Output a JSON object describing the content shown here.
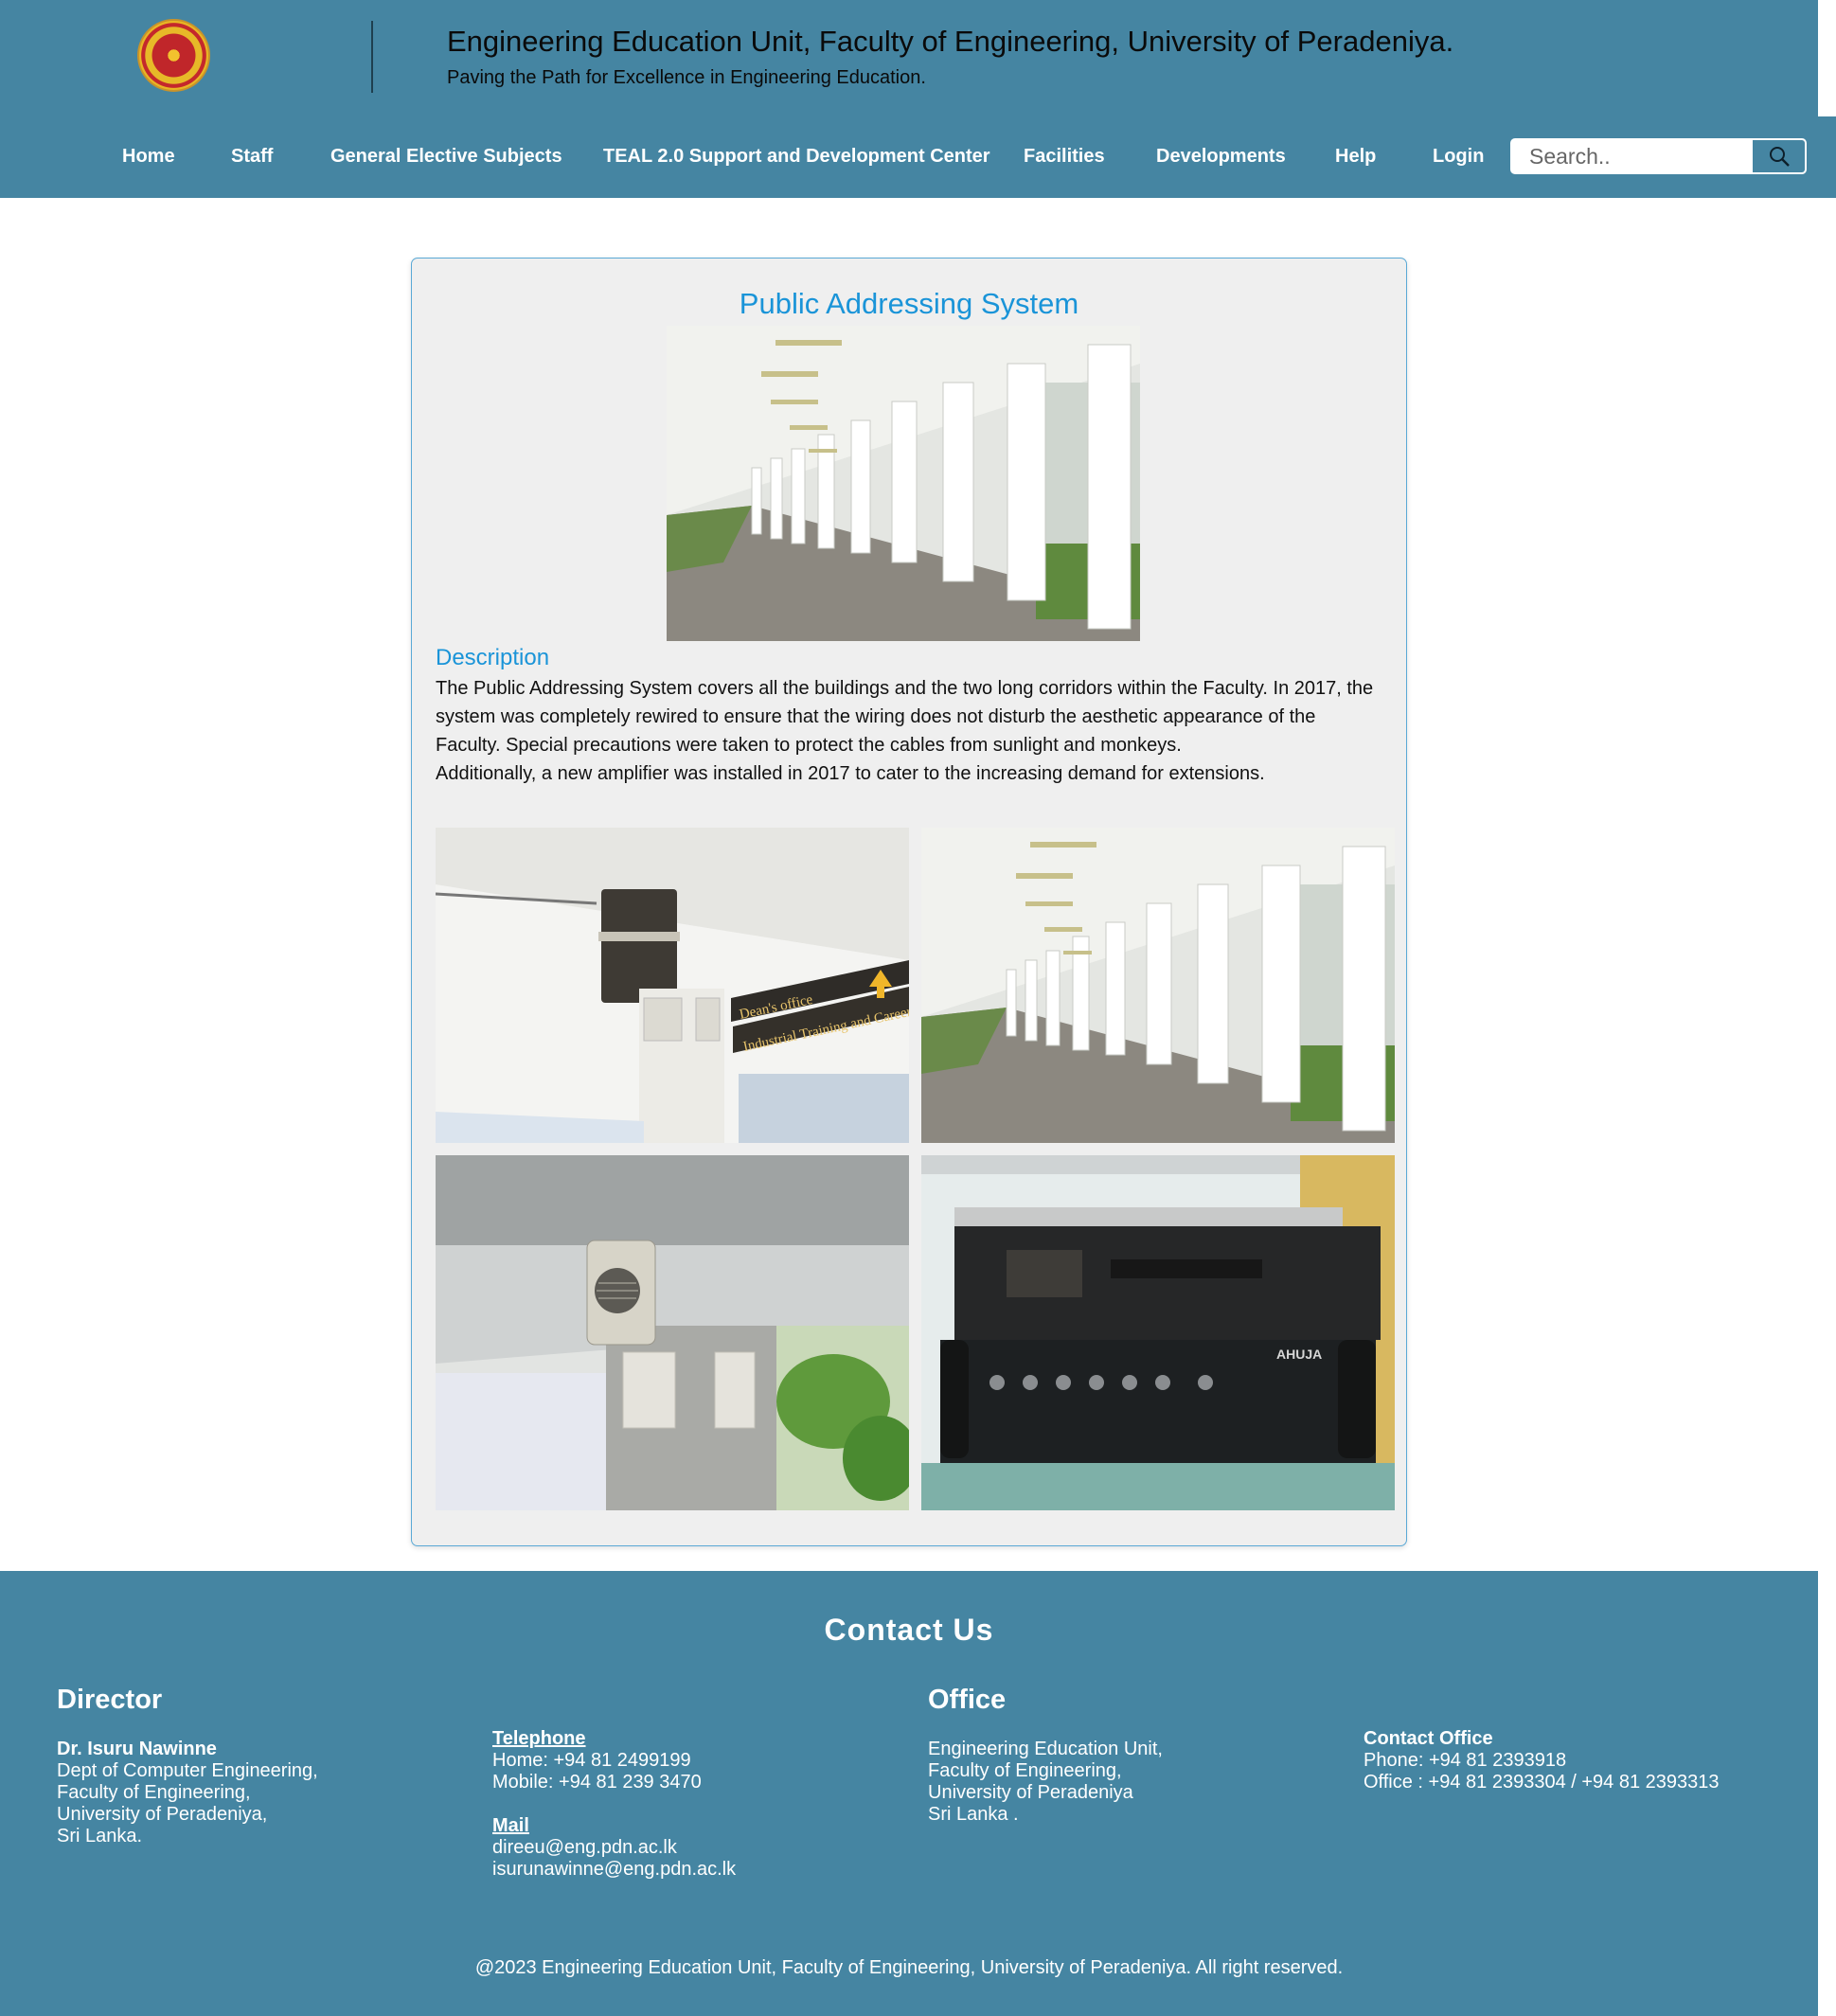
{
  "header": {
    "title": "Engineering Education Unit, Faculty of Engineering, University of Peradeniya.",
    "tagline": "Paving the Path for Excellence in Engineering Education."
  },
  "nav": {
    "items": [
      "Home",
      "Staff",
      "General Elective Subjects",
      "TEAL 2.0 Support and Development Center",
      "Facilities",
      "Developments",
      "Help",
      "Login"
    ]
  },
  "search": {
    "placeholder": "Search.."
  },
  "content": {
    "title": "Public Addressing System",
    "description_heading": "Description",
    "paragraph_1": "The Public Addressing System covers all the buildings and the two long corridors within the Faculty. In 2017, the system was completely rewired to ensure that the wiring does not disturb the aesthetic appearance of the Faculty. Special precautions were taken to protect the cables from sunlight and monkeys.",
    "paragraph_2": "Additionally, a new amplifier was installed in 2017 to cater to the increasing demand for extensions.",
    "sign_line_1": "Dean's office",
    "sign_line_2": "Industrial Training and Career",
    "amp_brand": "AHUJA"
  },
  "footer": {
    "contact_title": "Contact Us",
    "director_heading": "Director",
    "director_name": "Dr. Isuru Nawinne",
    "director_dept": "Dept of Computer Engineering,",
    "director_faculty": "Faculty of Engineering,",
    "director_uni": "University of Peradeniya,",
    "director_country": "Sri Lanka.",
    "telephone_label": "Telephone",
    "home_phone": "Home: +94 81 2499199",
    "mobile_phone": "Mobile: +94 81 239 3470",
    "mail_label": "Mail",
    "mail_1": "direeu@eng.pdn.ac.lk",
    "mail_2": "isurunawinne@eng.pdn.ac.lk",
    "office_heading": "Office",
    "office_line_1": "Engineering Education Unit,",
    "office_line_2": "Faculty of Engineering,",
    "office_line_3": "University of Peradeniya",
    "office_line_4": "Sri Lanka .",
    "contact_office_label": "Contact Office",
    "office_phone": "Phone: +94 81 2393918",
    "office_numbers": "Office : +94 81 2393304 / +94 81 2393313",
    "copyright": "@2023 Engineering Education Unit, Faculty of Engineering, University of Peradeniya. All right reserved."
  }
}
